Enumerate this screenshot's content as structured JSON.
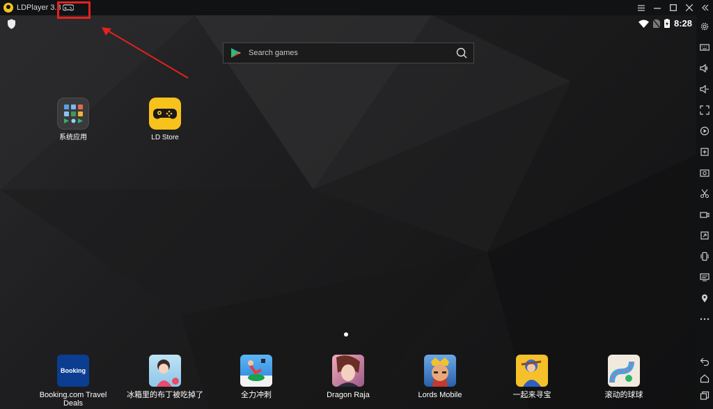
{
  "titlebar": {
    "app_name": "LDPlayer 3.8",
    "icons": [
      "gamepad-icon",
      "menu-icon",
      "minimize-icon",
      "maximize-icon",
      "close-icon",
      "collapse-icon"
    ]
  },
  "status": {
    "time": "8:28"
  },
  "search": {
    "placeholder": "Search games"
  },
  "home_apps": [
    {
      "label": "系统应用"
    },
    {
      "label": "LD Store"
    }
  ],
  "dock": [
    {
      "label": "Booking.com Travel Deals",
      "tile_text": "Booking"
    },
    {
      "label": "冰箱里的布丁被吃掉了"
    },
    {
      "label": "全力冲刺"
    },
    {
      "label": "Dragon Raja"
    },
    {
      "label": "Lords Mobile"
    },
    {
      "label": "一起来寻宝"
    },
    {
      "label": "滚动的球球"
    }
  ],
  "toolbar": [
    "settings-icon",
    "keyboard-icon",
    "volume-up-icon",
    "volume-down-icon",
    "fullscreen-icon",
    "record-icon",
    "add-window-icon",
    "screenshot-icon",
    "scissors-icon",
    "video-icon",
    "rotate-icon",
    "shake-icon",
    "operations-icon",
    "location-icon",
    "more-icon",
    "back-icon",
    "home-icon",
    "recent-icon"
  ],
  "colors": {
    "highlight": "#e3221e",
    "accent": "#f7c21b"
  }
}
